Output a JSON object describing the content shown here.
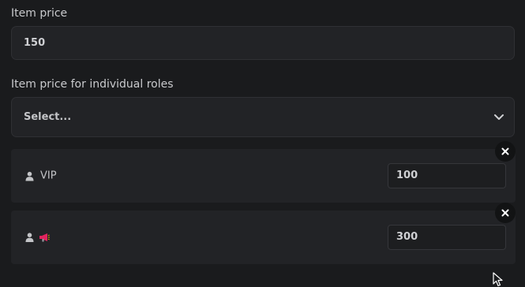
{
  "item_price": {
    "label": "Item price",
    "value": "150"
  },
  "role_prices": {
    "label": "Item price for individual roles",
    "select_placeholder": "Select...",
    "select_icon": "chevron-down-icon",
    "rows": [
      {
        "icons": [
          "user-icon"
        ],
        "role_name": "VIP",
        "price": "100",
        "remove_icon": "close-icon"
      },
      {
        "icons": [
          "user-icon",
          "megaphone-icon"
        ],
        "role_name": "",
        "price": "300",
        "remove_icon": "close-icon"
      }
    ]
  },
  "colors": {
    "background": "#1a1b1d",
    "field": "#222326",
    "text": "#cfd0d3",
    "megaphone_accent": "#e0245e"
  }
}
